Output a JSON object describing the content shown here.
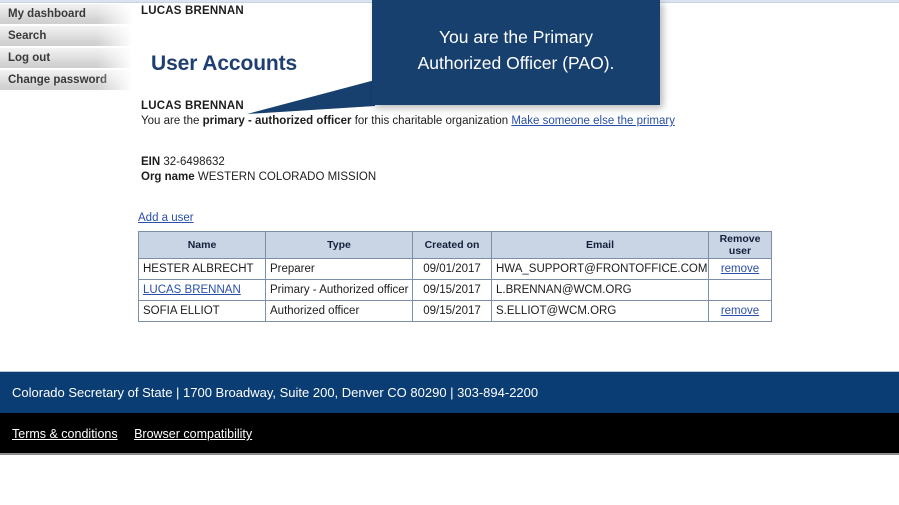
{
  "sidebar": {
    "items": [
      {
        "label": "My dashboard",
        "name": "sidebar-item-my-dashboard"
      },
      {
        "label": "Search",
        "name": "sidebar-item-search"
      },
      {
        "label": "Log out",
        "name": "sidebar-item-log-out"
      },
      {
        "label": "Change password",
        "name": "sidebar-item-change-password"
      }
    ]
  },
  "header": {
    "user_name": "LUCAS BRENNAN",
    "page_title": "User Accounts"
  },
  "callout": {
    "line1": "You are the Primary",
    "line2": "Authorized Officer (PAO).",
    "background_color": "#17406f",
    "text_color": "#ffffff"
  },
  "intro": {
    "name": "LUCAS BRENNAN",
    "prefix": "You are the ",
    "role": "primary - authorized officer",
    "suffix": " for this charitable organization ",
    "link_label": "Make someone else the primary"
  },
  "org": {
    "ein_label": "EIN",
    "ein_value": "32-6498632",
    "org_label": "Org name",
    "org_value": "WESTERN COLORADO MISSION"
  },
  "actions": {
    "add_user_label": "Add a user"
  },
  "table": {
    "columns": [
      "Name",
      "Type",
      "Created on",
      "Email",
      "Remove user"
    ],
    "rows": [
      {
        "name": "HESTER ALBRECHT",
        "name_is_link": false,
        "type": "Preparer",
        "created_on": "09/01/2017",
        "email": "HWA_SUPPORT@FRONTOFFICE.COM",
        "remove_label": "remove",
        "has_remove": true
      },
      {
        "name": "LUCAS BRENNAN",
        "name_is_link": true,
        "type": "Primary - Authorized officer",
        "created_on": "09/15/2017",
        "email": "L.BRENNAN@WCM.ORG",
        "remove_label": "",
        "has_remove": false
      },
      {
        "name": "SOFIA ELLIOT",
        "name_is_link": false,
        "type": "Authorized officer",
        "created_on": "09/15/2017",
        "email": "S.ELLIOT@WCM.ORG",
        "remove_label": "remove",
        "has_remove": true
      }
    ]
  },
  "footer": {
    "address_line": "Colorado Secretary of State | 1700 Broadway, Suite 200, Denver CO 80290 | 303-894-2200",
    "links": [
      {
        "label": "Terms & conditions",
        "name": "footer-link-terms-conditions"
      },
      {
        "label": "Browser compatibility",
        "name": "footer-link-browser-compatibility"
      }
    ],
    "navy_color": "#0b3d75",
    "black_color": "#000000"
  }
}
